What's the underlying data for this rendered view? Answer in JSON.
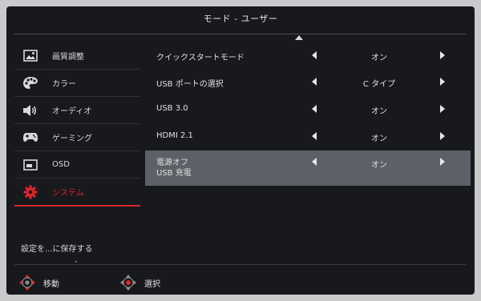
{
  "title": "モード - ユーザー",
  "sidebar": {
    "items": [
      {
        "label": "画質調整",
        "icon": "picture-icon"
      },
      {
        "label": "カラー",
        "icon": "palette-icon"
      },
      {
        "label": "オーディオ",
        "icon": "speaker-icon"
      },
      {
        "label": "ゲーミング",
        "icon": "gamepad-icon"
      },
      {
        "label": "OSD",
        "icon": "osd-icon"
      },
      {
        "label": "システム",
        "icon": "gear-icon",
        "active": true
      }
    ]
  },
  "settings": [
    {
      "label": "クイックスタートモード",
      "value": "オン"
    },
    {
      "label": "USB ポートの選択",
      "value": "C タイプ"
    },
    {
      "label": "USB 3.0",
      "value": "オン"
    },
    {
      "label": "HDMI 2.1",
      "value": "オン"
    },
    {
      "label_line1": "電源オフ",
      "label_line2": "USB 充電",
      "value": "オン",
      "selected": true
    }
  ],
  "save_label": "設定を...に保存する",
  "footer": {
    "move_label": "移動",
    "select_label": "選択"
  },
  "colors": {
    "background": "#17191c",
    "accent": "#e1262b",
    "selected_row": "#5b6167"
  }
}
